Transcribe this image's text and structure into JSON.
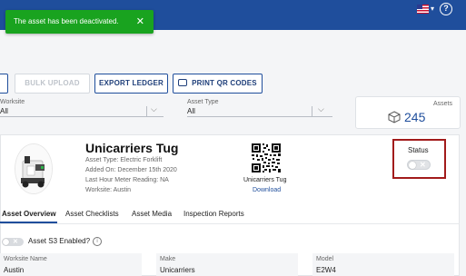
{
  "toast": {
    "message": "The asset has been deactivated.",
    "close": "✕"
  },
  "header": {
    "flag_caret": "▾",
    "help_icon": "?"
  },
  "toolbar": {
    "bulk_upload": "BULK UPLOAD",
    "export_ledger": "EXPORT LEDGER",
    "print_qr": "PRINT QR CODES"
  },
  "filters": {
    "worksite": {
      "label": "Worksite",
      "value": "All"
    },
    "asset_type": {
      "label": "Asset Type",
      "value": "All"
    }
  },
  "assets_summary": {
    "label": "Assets",
    "count": "245"
  },
  "asset": {
    "name": "Unicarriers Tug",
    "type_line": "Asset Type:   Electric Forklift",
    "added_line": "Added On: December 15th 2020",
    "meter_line": "Last Hour Meter Reading: NA",
    "worksite_line": "Worksite: Austin",
    "qr_caption": "Unicarriers Tug",
    "download": "Download"
  },
  "status": {
    "label": "Status",
    "active": false
  },
  "tabs": [
    {
      "label": "Asset Overview",
      "active": true
    },
    {
      "label": "Asset Checklists",
      "active": false
    },
    {
      "label": "Asset Media",
      "active": false
    },
    {
      "label": "Inspection Reports",
      "active": false
    }
  ],
  "overview": {
    "s3_label": "Asset S3 Enabled?",
    "s3_enabled": false,
    "fields": [
      {
        "label": "Worksite Name",
        "value": "Austin"
      },
      {
        "label": "Make",
        "value": "Unicarriers"
      },
      {
        "label": "Model",
        "value": "E2W4"
      }
    ]
  },
  "colors": {
    "brand": "#1f4e9c",
    "success": "#19a31f",
    "highlight": "#a21b1b"
  }
}
